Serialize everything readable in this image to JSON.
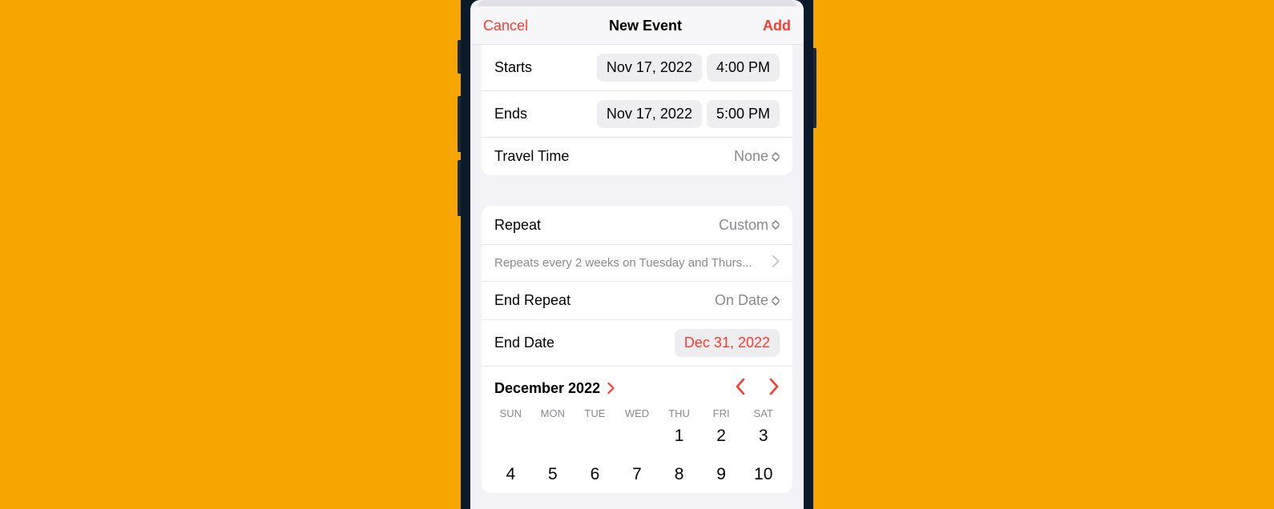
{
  "nav": {
    "cancel": "Cancel",
    "title": "New Event",
    "add": "Add"
  },
  "time_section": {
    "starts_label": "Starts",
    "starts_date": "Nov 17, 2022",
    "starts_time": "4:00 PM",
    "ends_label": "Ends",
    "ends_date": "Nov 17, 2022",
    "ends_time": "5:00 PM",
    "travel_label": "Travel Time",
    "travel_value": "None"
  },
  "repeat_section": {
    "repeat_label": "Repeat",
    "repeat_value": "Custom",
    "summary": "Repeats every 2 weeks on Tuesday and Thurs...",
    "end_repeat_label": "End Repeat",
    "end_repeat_value": "On Date",
    "end_date_label": "End Date",
    "end_date_value": "Dec 31, 2022"
  },
  "calendar": {
    "month_label": "December 2022",
    "weekdays": [
      "SUN",
      "MON",
      "TUE",
      "WED",
      "THU",
      "FRI",
      "SAT"
    ],
    "leading_blanks": 4,
    "days": [
      1,
      2,
      3,
      4,
      5,
      6,
      7,
      8,
      9,
      10
    ]
  }
}
